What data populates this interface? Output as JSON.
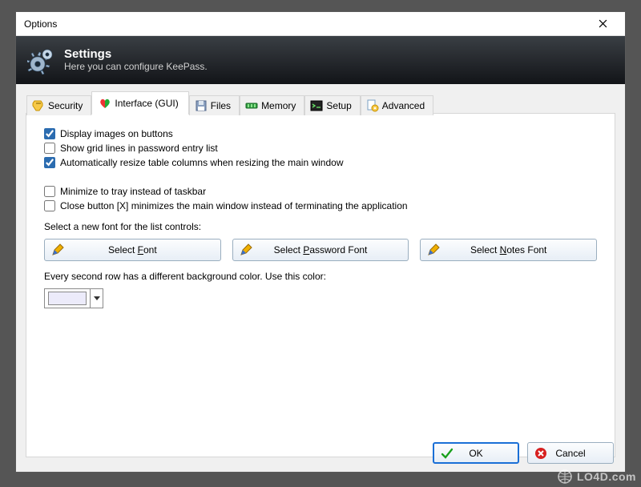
{
  "window": {
    "title": "Options"
  },
  "banner": {
    "heading": "Settings",
    "sub": "Here you can configure KeePass."
  },
  "tabs": {
    "security": "Security",
    "interface": "Interface (GUI)",
    "files": "Files",
    "memory": "Memory",
    "setup": "Setup",
    "advanced": "Advanced"
  },
  "checks": {
    "display_images": {
      "label": "Display images on buttons",
      "checked": true
    },
    "grid_lines": {
      "label": "Show grid lines in password entry list",
      "checked": false
    },
    "auto_resize": {
      "label": "Automatically resize table columns when resizing the main window",
      "checked": true
    },
    "min_tray": {
      "label": "Minimize to tray instead of taskbar",
      "checked": false
    },
    "close_min": {
      "label": "Close button [X] minimizes the main window instead of terminating the application",
      "checked": false
    }
  },
  "font": {
    "prompt": "Select a new font for the list controls:",
    "select_font": "Select Font",
    "select_pw_font": "Select Password Font",
    "select_notes_font": "Select Notes Font"
  },
  "color": {
    "prompt": "Every second row has a different background color. Use this color:",
    "value": "#ECEBFA"
  },
  "buttons": {
    "ok": "OK",
    "cancel": "Cancel"
  },
  "watermark": "LO4D.com"
}
